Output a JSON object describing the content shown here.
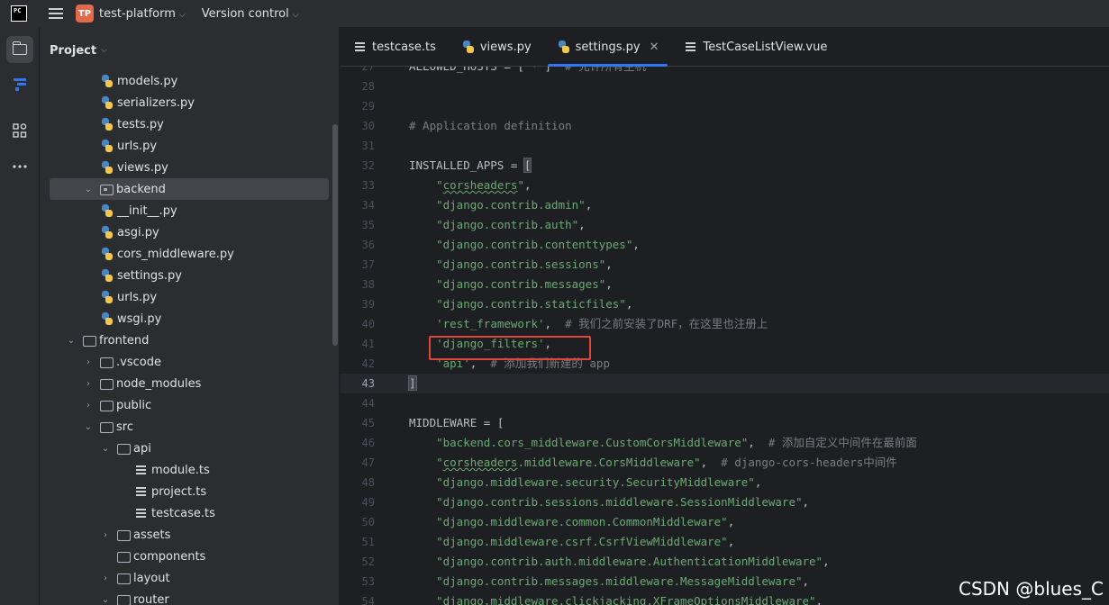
{
  "titlebar": {
    "logo": "PC",
    "project_badge": "TP",
    "project_name": "test-platform",
    "vcs_label": "Version control"
  },
  "toolstrip": {
    "items": [
      "project-folder-icon",
      "structure-icon",
      "plugins-icon",
      "more-icon"
    ]
  },
  "project_panel": {
    "title": "Project",
    "tree": [
      {
        "label": "models.py",
        "type": "py",
        "depth": 3
      },
      {
        "label": "serializers.py",
        "type": "py",
        "depth": 3
      },
      {
        "label": "tests.py",
        "type": "py",
        "depth": 3
      },
      {
        "label": "urls.py",
        "type": "py",
        "depth": 3
      },
      {
        "label": "views.py",
        "type": "py",
        "depth": 3
      },
      {
        "label": "backend",
        "type": "package",
        "depth": 2,
        "expanded": true,
        "selected": true
      },
      {
        "label": "__init__.py",
        "type": "py",
        "depth": 3
      },
      {
        "label": "asgi.py",
        "type": "py",
        "depth": 3
      },
      {
        "label": "cors_middleware.py",
        "type": "py",
        "depth": 3
      },
      {
        "label": "settings.py",
        "type": "py",
        "depth": 3
      },
      {
        "label": "urls.py",
        "type": "py",
        "depth": 3
      },
      {
        "label": "wsgi.py",
        "type": "py",
        "depth": 3
      },
      {
        "label": "frontend",
        "type": "folder",
        "depth": 1,
        "expanded": true
      },
      {
        "label": ".vscode",
        "type": "folder",
        "depth": 2,
        "expanded": false
      },
      {
        "label": "node_modules",
        "type": "folder",
        "depth": 2,
        "expanded": false
      },
      {
        "label": "public",
        "type": "folder",
        "depth": 2,
        "expanded": false
      },
      {
        "label": "src",
        "type": "folder",
        "depth": 2,
        "expanded": true
      },
      {
        "label": "api",
        "type": "folder",
        "depth": 3,
        "expanded": true
      },
      {
        "label": "module.ts",
        "type": "ts",
        "depth": 5
      },
      {
        "label": "project.ts",
        "type": "ts",
        "depth": 5
      },
      {
        "label": "testcase.ts",
        "type": "ts",
        "depth": 5
      },
      {
        "label": "assets",
        "type": "folder",
        "depth": 3,
        "expanded": false
      },
      {
        "label": "components",
        "type": "folder",
        "depth": 3,
        "leaf": true
      },
      {
        "label": "layout",
        "type": "folder",
        "depth": 3,
        "expanded": false
      },
      {
        "label": "router",
        "type": "folder",
        "depth": 3,
        "expanded": true
      }
    ]
  },
  "editor": {
    "tabs": [
      {
        "label": "testcase.ts",
        "icon": "ts-file-icon",
        "active": false
      },
      {
        "label": "views.py",
        "icon": "python-file-icon",
        "active": false
      },
      {
        "label": "settings.py",
        "icon": "python-file-icon",
        "active": true,
        "closable": true
      },
      {
        "label": "TestCaseListView.vue",
        "icon": "vue-file-icon",
        "active": false
      }
    ],
    "close_glyph": "✕",
    "current_line": "43",
    "lines": [
      {
        "n": "27",
        "text": "ALLOWED_HOSTS = ['*']  # 允许所有主机"
      },
      {
        "n": "28",
        "text": ""
      },
      {
        "n": "29",
        "text": ""
      },
      {
        "n": "30",
        "text": "# Application definition"
      },
      {
        "n": "31",
        "text": ""
      },
      {
        "n": "32",
        "text": "INSTALLED_APPS = ["
      },
      {
        "n": "33",
        "text": "    \"corsheaders\","
      },
      {
        "n": "34",
        "text": "    \"django.contrib.admin\","
      },
      {
        "n": "35",
        "text": "    \"django.contrib.auth\","
      },
      {
        "n": "36",
        "text": "    \"django.contrib.contenttypes\","
      },
      {
        "n": "37",
        "text": "    \"django.contrib.sessions\","
      },
      {
        "n": "38",
        "text": "    \"django.contrib.messages\","
      },
      {
        "n": "39",
        "text": "    \"django.contrib.staticfiles\","
      },
      {
        "n": "40",
        "text": "    'rest_framework',  # 我们之前安装了DRF，在这里也注册上"
      },
      {
        "n": "41",
        "text": "    'django_filters',"
      },
      {
        "n": "42",
        "text": "    'api',  # 添加我们新建的 app"
      },
      {
        "n": "43",
        "text": "]"
      },
      {
        "n": "44",
        "text": ""
      },
      {
        "n": "45",
        "text": "MIDDLEWARE = ["
      },
      {
        "n": "46",
        "text": "    \"backend.cors_middleware.CustomCorsMiddleware\",  # 添加自定义中间件在最前面"
      },
      {
        "n": "47",
        "text": "    \"corsheaders.middleware.CorsMiddleware\",  # django-cors-headers中间件"
      },
      {
        "n": "48",
        "text": "    \"django.middleware.security.SecurityMiddleware\","
      },
      {
        "n": "49",
        "text": "    \"django.contrib.sessions.middleware.SessionMiddleware\","
      },
      {
        "n": "50",
        "text": "    \"django.middleware.common.CommonMiddleware\","
      },
      {
        "n": "51",
        "text": "    \"django.middleware.csrf.CsrfViewMiddleware\","
      },
      {
        "n": "52",
        "text": "    \"django.contrib.auth.middleware.AuthenticationMiddleware\","
      },
      {
        "n": "53",
        "text": "    \"django.contrib.messages.middleware.MessageMiddleware\","
      },
      {
        "n": "54",
        "text": "    \"django.middleware.clickjacking.XFrameOptionsMiddleware\","
      }
    ]
  },
  "watermark": "CSDN @blues_C",
  "colors": {
    "string": "#6aab73",
    "comment": "#7a7e85",
    "accent": "#3574f0",
    "highlight_box": "#e0473b"
  }
}
